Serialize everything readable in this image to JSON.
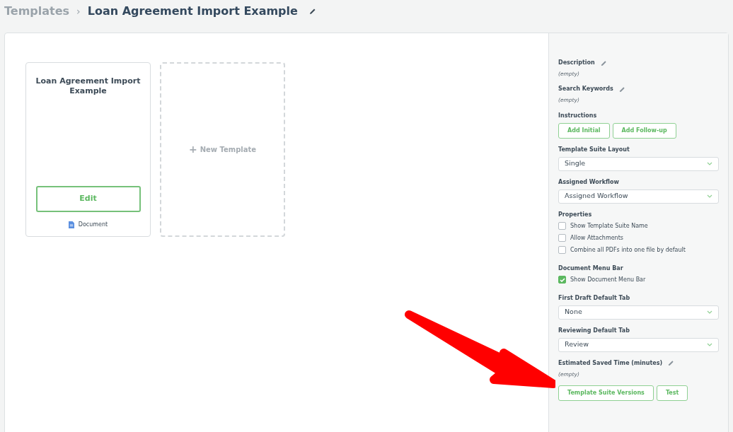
{
  "breadcrumb": {
    "parent": "Templates",
    "separator": "›",
    "title": "Loan Agreement Import Example"
  },
  "templates": [
    {
      "title": "Loan Agreement Import Example",
      "button": "Edit",
      "type_label": "Document"
    }
  ],
  "new_template": {
    "icon": "+",
    "label": "New Template"
  },
  "sidebar": {
    "sections": [
      {
        "kind": "editable",
        "label": "Description",
        "value": "(empty)"
      },
      {
        "kind": "editable",
        "label": "Search Keywords",
        "value": "(empty)"
      },
      {
        "kind": "buttons",
        "label": "Instructions",
        "buttons": [
          "Add Initial",
          "Add Follow-up"
        ]
      },
      {
        "kind": "select",
        "label": "Template Suite Layout",
        "value": "Single"
      },
      {
        "kind": "select",
        "label": "Assigned Workflow",
        "value": "Assigned Workflow"
      },
      {
        "kind": "checkboxes",
        "label": "Properties",
        "items": [
          {
            "label": "Show Template Suite Name",
            "checked": false
          },
          {
            "label": "Allow Attachments",
            "checked": false
          },
          {
            "label": "Combine all PDFs into one file by default",
            "checked": false
          }
        ]
      },
      {
        "kind": "checkboxes",
        "label": "Document Menu Bar",
        "items": [
          {
            "label": "Show Document Menu Bar",
            "checked": true
          }
        ]
      },
      {
        "kind": "select",
        "label": "First Draft Default Tab",
        "value": "None"
      },
      {
        "kind": "select",
        "label": "Reviewing Default Tab",
        "value": "Review"
      },
      {
        "kind": "editable",
        "label": "Estimated Saved Time (minutes)",
        "value": "(empty)"
      },
      {
        "kind": "actions",
        "buttons": [
          "Template Suite Versions",
          "Test"
        ]
      }
    ]
  }
}
